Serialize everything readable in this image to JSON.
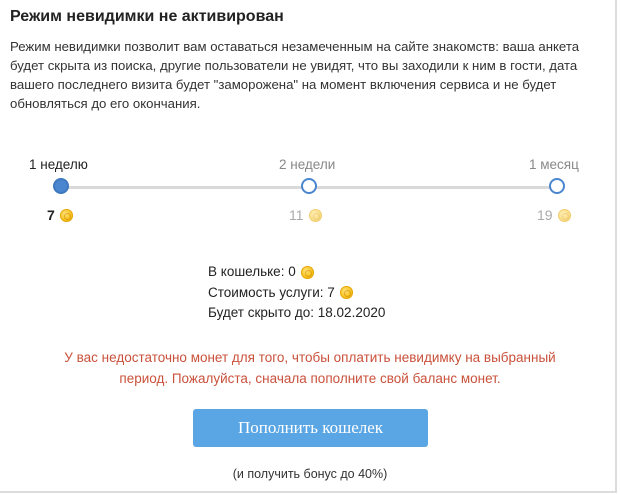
{
  "header": {
    "title": "Режим невидимки не активирован"
  },
  "description": "Режим невидимки позволит вам оставаться незамеченным на сайте знакомств: ваша анкета будет скрыта из поиска, другие пользователи не увидят, что вы заходили к ним в гости, дата вашего последнего визита будет \"заморожена\" на момент включения сервиса и не будет обновляться до его окончания.",
  "periods": [
    {
      "label": "1 неделю",
      "price": "7",
      "selected": true
    },
    {
      "label": "2 недели",
      "price": "11",
      "selected": false
    },
    {
      "label": "1 месяц",
      "price": "19",
      "selected": false
    }
  ],
  "summary": {
    "wallet_label": "В кошельке: 0",
    "cost_label": "Стоимость услуги: 7",
    "hidden_until_label": "Будет скрыто до: 18.02.2020"
  },
  "warning": "У вас недостаточно монет для того, чтобы оплатить невидимку на выбранный период. Пожалуйста, сначала пополните свой баланс монет.",
  "actions": {
    "top_up_label": "Пополнить кошелек",
    "bonus_note": "(и получить бонус до 40%)"
  },
  "colors": {
    "accent": "#4a86cf",
    "button": "#5aa6e4",
    "warning": "#c9513b",
    "coin": "#f7c21c"
  },
  "icons": {
    "coin": "coin-icon"
  }
}
